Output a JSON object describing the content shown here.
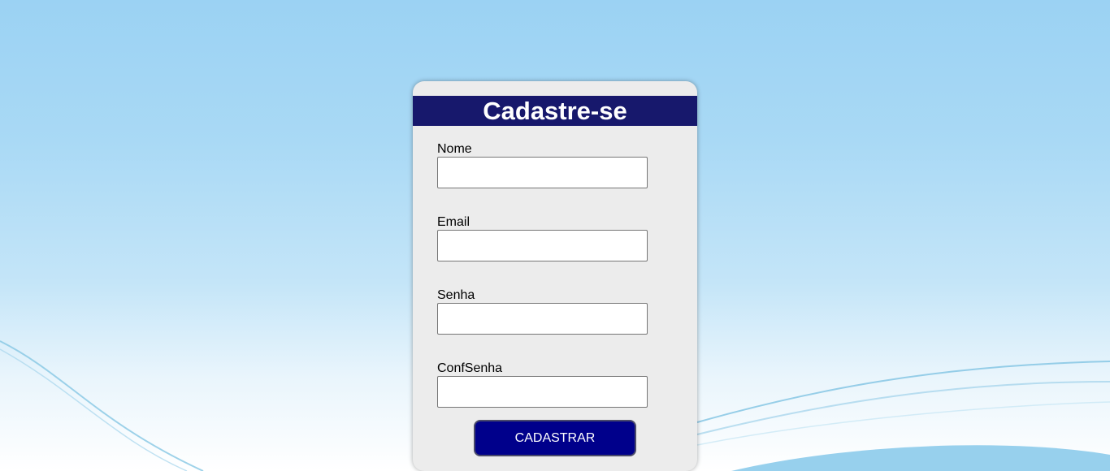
{
  "page": {
    "background_top_color": "#9bd2f3",
    "background_bottom_color": "#ffffff",
    "wave_color": "#7fc3e2"
  },
  "form": {
    "title": "Cadastre-se",
    "header_color": "#17186c",
    "fields": [
      {
        "label": "Nome",
        "value": "",
        "placeholder": ""
      },
      {
        "label": "Email",
        "value": "",
        "placeholder": ""
      },
      {
        "label": "Senha",
        "value": "",
        "placeholder": ""
      },
      {
        "label": "ConfSenha",
        "value": "",
        "placeholder": ""
      }
    ],
    "submit_label": "CADASTRAR",
    "submit_color": "#00008b"
  }
}
